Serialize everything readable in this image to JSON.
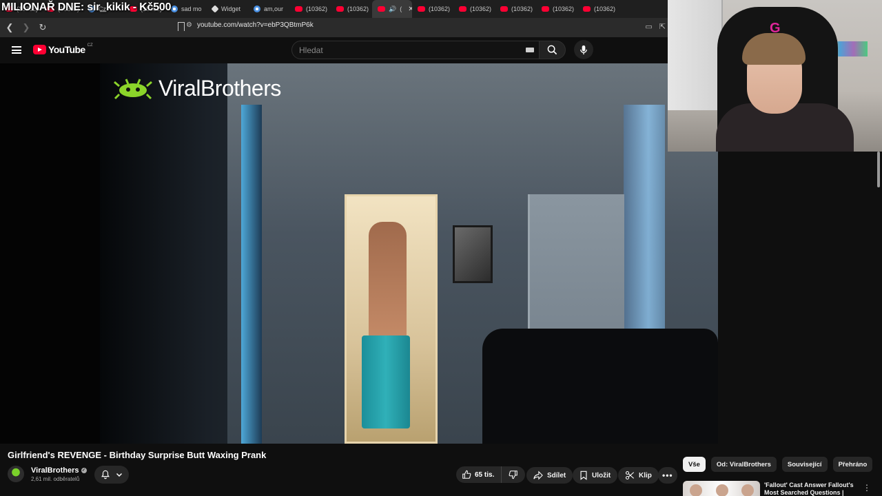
{
  "stream_overlay": {
    "text": "MILIONAŘ DNE: sir_kikik - Kč500"
  },
  "browser": {
    "tabs": [
      {
        "label": "(10362)",
        "icon": "youtube-icon"
      },
      {
        "label": "(10362)",
        "icon": "youtube-icon"
      },
      {
        "label": "Cz",
        "icon": "google-icon"
      },
      {
        "label": "(10362)",
        "icon": "youtube-icon"
      },
      {
        "label": "sad mo",
        "icon": "google-icon"
      },
      {
        "label": "Widget",
        "icon": "widget-icon"
      },
      {
        "label": "am,our",
        "icon": "google-icon"
      },
      {
        "label": "(10362)",
        "icon": "youtube-icon"
      },
      {
        "label": "(10362)",
        "icon": "youtube-icon"
      },
      {
        "label": "(",
        "icon": "youtube-icon",
        "active": true
      },
      {
        "label": "(10362)",
        "icon": "youtube-icon"
      },
      {
        "label": "(10362)",
        "icon": "youtube-icon"
      },
      {
        "label": "(10362)",
        "icon": "youtube-icon"
      },
      {
        "label": "(10362)",
        "icon": "youtube-icon"
      },
      {
        "label": "(10362)",
        "icon": "youtube-icon"
      }
    ],
    "url": "youtube.com/watch?v=ebP3QBtmP6k"
  },
  "youtube": {
    "logo_text": "YouTube",
    "country": "CZ",
    "search_placeholder": "Hledat"
  },
  "video": {
    "watermark": "ViralBrothers",
    "title": "Girlfriend's REVENGE - Birthday Surprise Butt Waxing Prank",
    "channel_name": "ViralBrothers",
    "subscribers": "2,61 mil. odběratelů",
    "likes": "65 tis.",
    "share_label": "Sdílet",
    "save_label": "Uložit",
    "clip_label": "Klip"
  },
  "chips": [
    "Vše",
    "Od: ViralBrothers",
    "Související",
    "Přehráno"
  ],
  "recommendation": {
    "title": "'Fallout' Cast Answer Fallout's Most Searched Questions |"
  },
  "colors": {
    "youtube_red": "#ff0033",
    "background": "#0f0f0f",
    "pill": "#272727"
  }
}
